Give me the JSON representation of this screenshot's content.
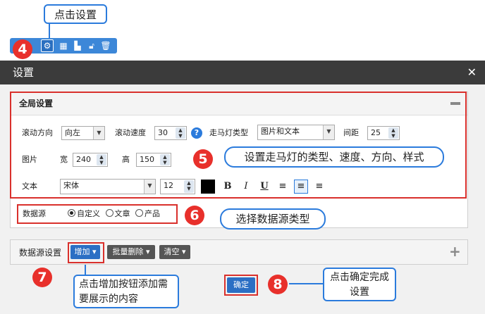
{
  "callouts": {
    "c1": "点击设置",
    "c5": "设置走马灯的类型、速度、方向、样式",
    "c6": "选择数据源类型",
    "c7": "点击增加按钮添加需要展示的内容",
    "c8": "点击确定完成设置"
  },
  "badges": {
    "b4": "4",
    "b5": "5",
    "b6": "6",
    "b7": "7",
    "b8": "8"
  },
  "toolbar": {
    "icons": [
      "gear-icon",
      "table-icon",
      "bar-chart-icon",
      "unlock-icon",
      "trash-icon"
    ]
  },
  "dialog": {
    "title": "设置",
    "close": "✕",
    "global": {
      "header": "全局设置",
      "collapse": "—",
      "direction_label": "滚动方向",
      "direction_value": "向左",
      "speed_label": "滚动速度",
      "speed_value": "30",
      "help": "?",
      "type_label": "走马灯类型",
      "type_value": "图片和文本",
      "spacing_label": "间距",
      "spacing_value": "25",
      "image_label": "图片",
      "width_label": "宽",
      "width_value": "240",
      "height_label": "高",
      "height_value": "150",
      "text_label": "文本",
      "font_value": "宋体",
      "size_value": "12",
      "text_color": "#000000",
      "bold": "B",
      "italic": "I",
      "underline": "U"
    },
    "datasource": {
      "label": "数据源",
      "options": [
        "自定义",
        "文章",
        "产品"
      ],
      "selected": "自定义"
    },
    "ds_settings": {
      "label": "数据源设置",
      "add": "增加",
      "batch_delete": "批量删除",
      "clear": "清空",
      "expand": "+"
    },
    "ok": "确定"
  },
  "colors": {
    "accent": "#2b7bdc",
    "badge": "#e8302b",
    "titlebar": "#3b3b3b"
  }
}
